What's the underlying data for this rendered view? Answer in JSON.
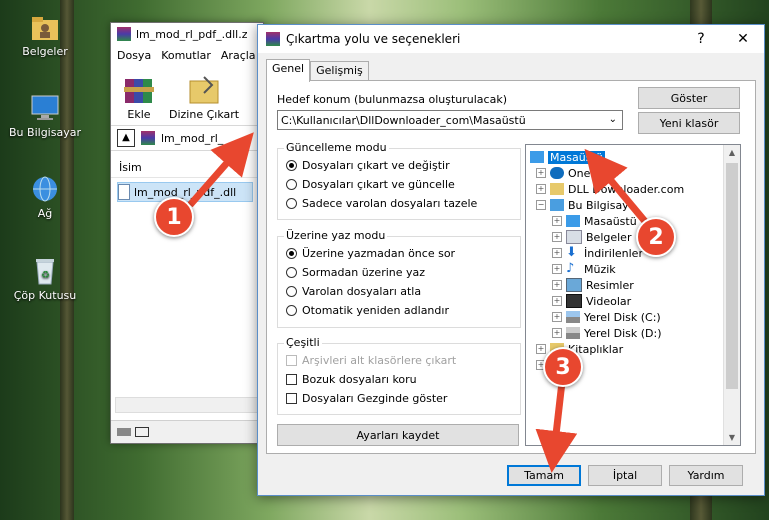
{
  "desktop": {
    "icons": [
      {
        "label": "Belgeler",
        "icon": "folder-user-icon"
      },
      {
        "label": "Bu Bilgisayar",
        "icon": "computer-icon"
      },
      {
        "label": "Ağ",
        "icon": "network-globe-icon"
      },
      {
        "label": "Çöp Kutusu",
        "icon": "recycle-bin-icon"
      }
    ]
  },
  "winrar": {
    "title": "lm_mod_rl_pdf_.dll.z",
    "menu": [
      "Dosya",
      "Komutlar",
      "Araçla"
    ],
    "toolbar": {
      "extract_label": "Ekle",
      "extract_to_label": "Dizine Çıkart"
    },
    "address": "lm_mod_rl_",
    "column_name": "İsim",
    "file": "lm_mod_rl_pdf_.dll"
  },
  "dialog": {
    "title": "Çıkartma yolu ve seçenekleri",
    "help": "?",
    "close": "✕",
    "tabs": [
      "Genel",
      "Gelişmiş"
    ],
    "dest_label": "Hedef konum (bulunmazsa oluşturulacak)",
    "dest_value": "C:\\Kullanıcılar\\DllDownloader_com\\Masaüstü",
    "show_button": "Göster",
    "new_folder_button": "Yeni klasör",
    "update_mode": {
      "title": "Güncelleme modu",
      "options": [
        "Dosyaları çıkart ve değiştir",
        "Dosyaları çıkart ve güncelle",
        "Sadece varolan dosyaları tazele"
      ],
      "selected": 0
    },
    "overwrite_mode": {
      "title": "Üzerine yaz modu",
      "options": [
        "Üzerine yazmadan önce sor",
        "Sormadan üzerine yaz",
        "Varolan dosyaları atla",
        "Otomatik yeniden adlandır"
      ],
      "selected": 0
    },
    "misc": {
      "title": "Çeşitli",
      "options": [
        "Arşivleri alt klasörlere çıkart",
        "Bozuk dosyaları koru",
        "Dosyaları Gezginde göster"
      ]
    },
    "save_settings": "Ayarları kaydet",
    "tree": [
      {
        "label": "Masaüstü",
        "icon": "desktop-icon",
        "selected": true
      },
      {
        "label": "OneD",
        "icon": "onedrive-icon"
      },
      {
        "label": "DLL Downloader.com",
        "icon": "user-folder-icon"
      },
      {
        "label": "Bu Bilgisaya",
        "icon": "computer-icon"
      },
      {
        "label": "Masaüstü",
        "icon": "desktop-icon"
      },
      {
        "label": "Belgeler",
        "icon": "documents-icon"
      },
      {
        "label": "İndirilenler",
        "icon": "download-icon"
      },
      {
        "label": "Müzik",
        "icon": "music-icon"
      },
      {
        "label": "Resimler",
        "icon": "pictures-icon"
      },
      {
        "label": "Videolar",
        "icon": "videos-icon"
      },
      {
        "label": "Yerel Disk (C:)",
        "icon": "drive-icon"
      },
      {
        "label": "Yerel Disk (D:)",
        "icon": "drive-icon"
      },
      {
        "label": "Kitaplıklar",
        "icon": "library-icon"
      },
      {
        "label": "Ağ",
        "icon": "network-icon"
      }
    ],
    "ok": "Tamam",
    "cancel": "İptal",
    "help_button": "Yardım"
  },
  "annotations": [
    "1",
    "2",
    "3"
  ],
  "colors": {
    "annotation": "#e8472f",
    "selection": "#0078d7"
  }
}
